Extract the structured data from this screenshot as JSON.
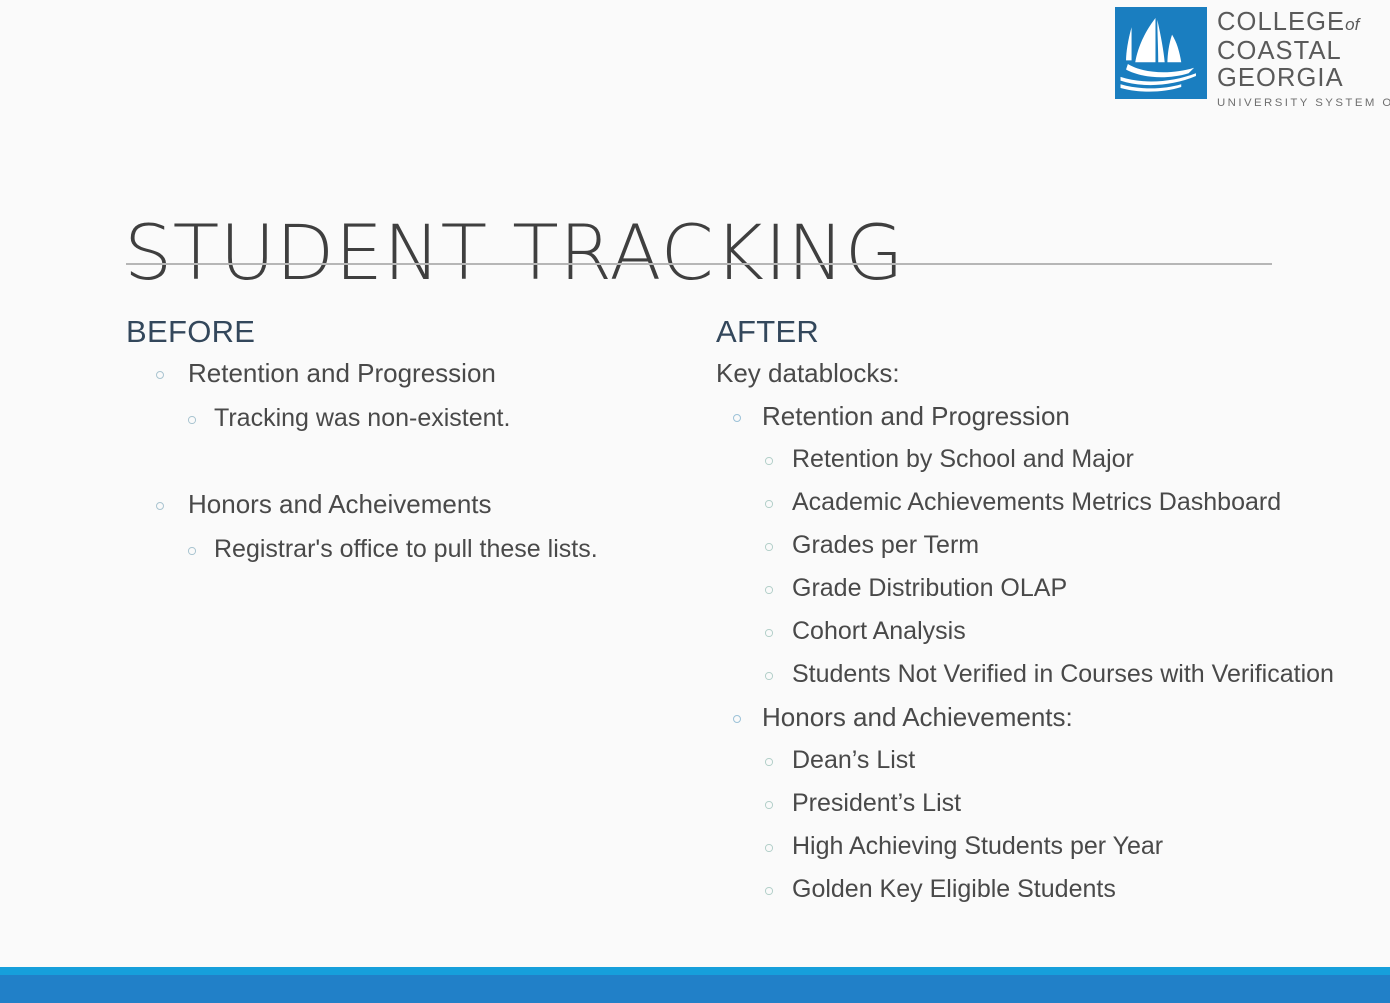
{
  "logo": {
    "mark_name": "sailboat-logo",
    "mark_color": "#1a7ec0",
    "line1": "COLLEGE",
    "line1_suffix": "of",
    "line2": "COASTAL",
    "line3": "GEORGIA",
    "tagline": "UNIVERSITY SYSTEM OF GEORGIA"
  },
  "title": "STUDENT TRACKING",
  "columns": {
    "before": {
      "heading": "BEFORE",
      "items": [
        {
          "level": 1,
          "text": "Retention and Progression"
        },
        {
          "level": 2,
          "text": "Tracking was non-existent."
        },
        {
          "level": 0,
          "text": ""
        },
        {
          "level": 1,
          "text": "Honors and Acheivements"
        },
        {
          "level": 2,
          "text": "Registrar's office to pull these lists."
        }
      ]
    },
    "after": {
      "heading": "AFTER",
      "intro": "Key datablocks:",
      "items": [
        {
          "level": 1,
          "text": "Retention and Progression"
        },
        {
          "level": 2,
          "text": "Retention by School and Major"
        },
        {
          "level": 2,
          "text": "Academic Achievements Metrics Dashboard"
        },
        {
          "level": 2,
          "text": "Grades per Term"
        },
        {
          "level": 2,
          "text": "Grade Distribution OLAP"
        },
        {
          "level": 2,
          "text": "Cohort Analysis"
        },
        {
          "level": 2,
          "text": "Students Not Verified in Courses with Verification"
        },
        {
          "level": 1,
          "text": "Honors and Achievements:"
        },
        {
          "level": 2,
          "text": "Dean’s List"
        },
        {
          "level": 2,
          "text": "President’s List"
        },
        {
          "level": 2,
          "text": "High Achieving Students per Year"
        },
        {
          "level": 2,
          "text": "Golden Key Eligible Students"
        }
      ]
    }
  },
  "colors": {
    "background": "#fafafa",
    "title_text": "#3f3f3f",
    "heading_text": "#33475b",
    "body_text": "#494949",
    "rule": "#b6b6b6",
    "bar_light": "#169fdb",
    "bar_dark": "#2180c8",
    "bullet": "#a9c4d0"
  }
}
